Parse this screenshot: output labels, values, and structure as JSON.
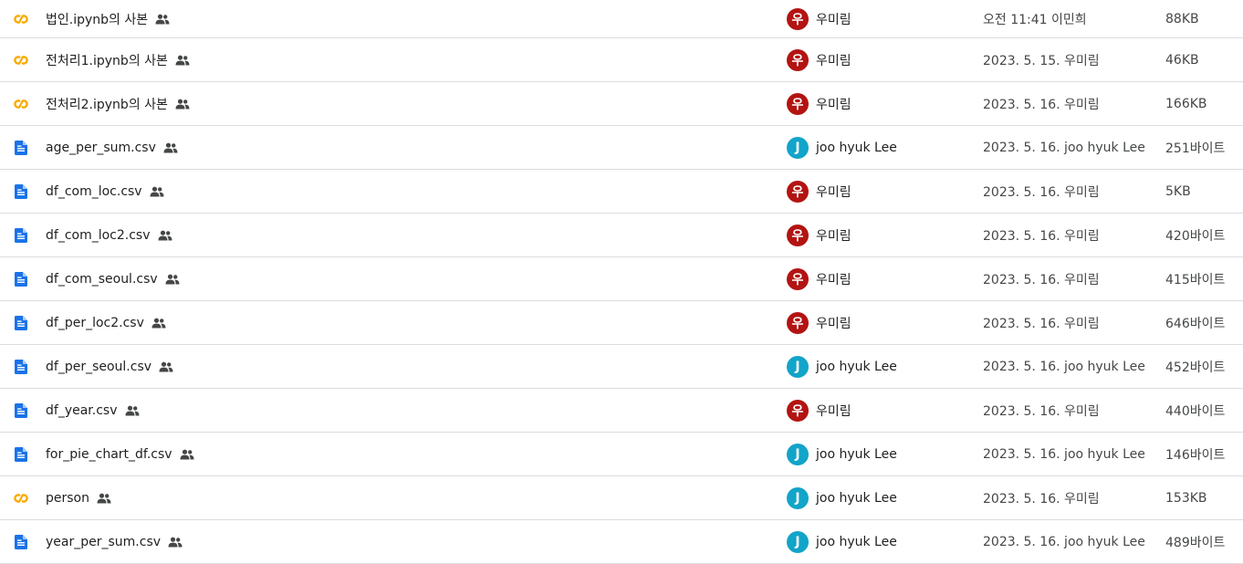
{
  "colors": {
    "avatar_red": "#b31412",
    "avatar_teal": "#12a4c9",
    "colab_orange": "#f9ab00",
    "doc_blue": "#1a73e8",
    "divider": "#dadce0"
  },
  "files": [
    {
      "icon": "colab-icon",
      "name": "법인.ipynb의 사본",
      "shared_icon": "people-icon",
      "owner": {
        "initial": "우",
        "name": "우미림",
        "color": "#b31412"
      },
      "modified": "오전 11:41 이민희",
      "size": "88KB"
    },
    {
      "icon": "colab-icon",
      "name": "전처리1.ipynb의 사본",
      "shared_icon": "people-icon",
      "owner": {
        "initial": "우",
        "name": "우미림",
        "color": "#b31412"
      },
      "modified": "2023. 5. 15. 우미림",
      "size": "46KB"
    },
    {
      "icon": "colab-icon",
      "name": "전처리2.ipynb의 사본",
      "shared_icon": "people-icon",
      "owner": {
        "initial": "우",
        "name": "우미림",
        "color": "#b31412"
      },
      "modified": "2023. 5. 16. 우미림",
      "size": "166KB"
    },
    {
      "icon": "doc-icon",
      "name": "age_per_sum.csv",
      "shared_icon": "people-icon",
      "owner": {
        "initial": "J",
        "name": "joo hyuk Lee",
        "color": "#12a4c9"
      },
      "modified": "2023. 5. 16. joo hyuk Lee",
      "size": "251바이트"
    },
    {
      "icon": "doc-icon",
      "name": "df_com_loc.csv",
      "shared_icon": "people-icon",
      "owner": {
        "initial": "우",
        "name": "우미림",
        "color": "#b31412"
      },
      "modified": "2023. 5. 16. 우미림",
      "size": "5KB"
    },
    {
      "icon": "doc-icon",
      "name": "df_com_loc2.csv",
      "shared_icon": "people-icon",
      "owner": {
        "initial": "우",
        "name": "우미림",
        "color": "#b31412"
      },
      "modified": "2023. 5. 16. 우미림",
      "size": "420바이트"
    },
    {
      "icon": "doc-icon",
      "name": "df_com_seoul.csv",
      "shared_icon": "people-icon",
      "owner": {
        "initial": "우",
        "name": "우미림",
        "color": "#b31412"
      },
      "modified": "2023. 5. 16. 우미림",
      "size": "415바이트"
    },
    {
      "icon": "doc-icon",
      "name": "df_per_loc2.csv",
      "shared_icon": "people-icon",
      "owner": {
        "initial": "우",
        "name": "우미림",
        "color": "#b31412"
      },
      "modified": "2023. 5. 16. 우미림",
      "size": "646바이트"
    },
    {
      "icon": "doc-icon",
      "name": "df_per_seoul.csv",
      "shared_icon": "people-icon",
      "owner": {
        "initial": "J",
        "name": "joo hyuk Lee",
        "color": "#12a4c9"
      },
      "modified": "2023. 5. 16. joo hyuk Lee",
      "size": "452바이트"
    },
    {
      "icon": "doc-icon",
      "name": "df_year.csv",
      "shared_icon": "people-icon",
      "owner": {
        "initial": "우",
        "name": "우미림",
        "color": "#b31412"
      },
      "modified": "2023. 5. 16. 우미림",
      "size": "440바이트"
    },
    {
      "icon": "doc-icon",
      "name": "for_pie_chart_df.csv",
      "shared_icon": "people-icon",
      "owner": {
        "initial": "J",
        "name": "joo hyuk Lee",
        "color": "#12a4c9"
      },
      "modified": "2023. 5. 16. joo hyuk Lee",
      "size": "146바이트"
    },
    {
      "icon": "colab-icon",
      "name": "person",
      "shared_icon": "people-icon",
      "owner": {
        "initial": "J",
        "name": "joo hyuk Lee",
        "color": "#12a4c9"
      },
      "modified": "2023. 5. 16. 우미림",
      "size": "153KB"
    },
    {
      "icon": "doc-icon",
      "name": "year_per_sum.csv",
      "shared_icon": "people-icon",
      "owner": {
        "initial": "J",
        "name": "joo hyuk Lee",
        "color": "#12a4c9"
      },
      "modified": "2023. 5. 16. joo hyuk Lee",
      "size": "489바이트"
    }
  ]
}
